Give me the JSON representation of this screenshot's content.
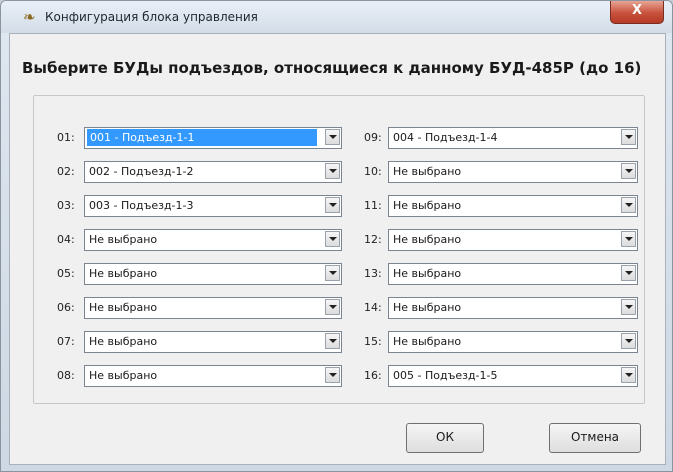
{
  "window": {
    "title": "Конфигурация блока управления",
    "close_glyph": "X",
    "icon": "app-icon"
  },
  "heading": "Выберите БУДы подъездов, относящиеся к данному БУД-485Р (до 16)",
  "left_column": [
    {
      "num": "01:",
      "value": "001 - Подъезд-1-1",
      "selected": true
    },
    {
      "num": "02:",
      "value": "002 - Подъезд-1-2"
    },
    {
      "num": "03:",
      "value": "003 - Подъезд-1-3"
    },
    {
      "num": "04:",
      "value": "Не выбрано"
    },
    {
      "num": "05:",
      "value": "Не выбрано"
    },
    {
      "num": "06:",
      "value": "Не выбрано"
    },
    {
      "num": "07:",
      "value": "Не выбрано"
    },
    {
      "num": "08:",
      "value": "Не выбрано"
    }
  ],
  "right_column": [
    {
      "num": "09:",
      "value": "004 - Подъезд-1-4"
    },
    {
      "num": "10:",
      "value": "Не выбрано"
    },
    {
      "num": "11:",
      "value": "Не выбрано"
    },
    {
      "num": "12:",
      "value": "Не выбрано"
    },
    {
      "num": "13:",
      "value": "Не выбрано"
    },
    {
      "num": "14:",
      "value": "Не выбрано"
    },
    {
      "num": "15:",
      "value": "Не выбрано"
    },
    {
      "num": "16:",
      "value": "005 - Подъезд-1-5"
    }
  ],
  "buttons": {
    "ok": "ОК",
    "cancel": "Отмена"
  }
}
